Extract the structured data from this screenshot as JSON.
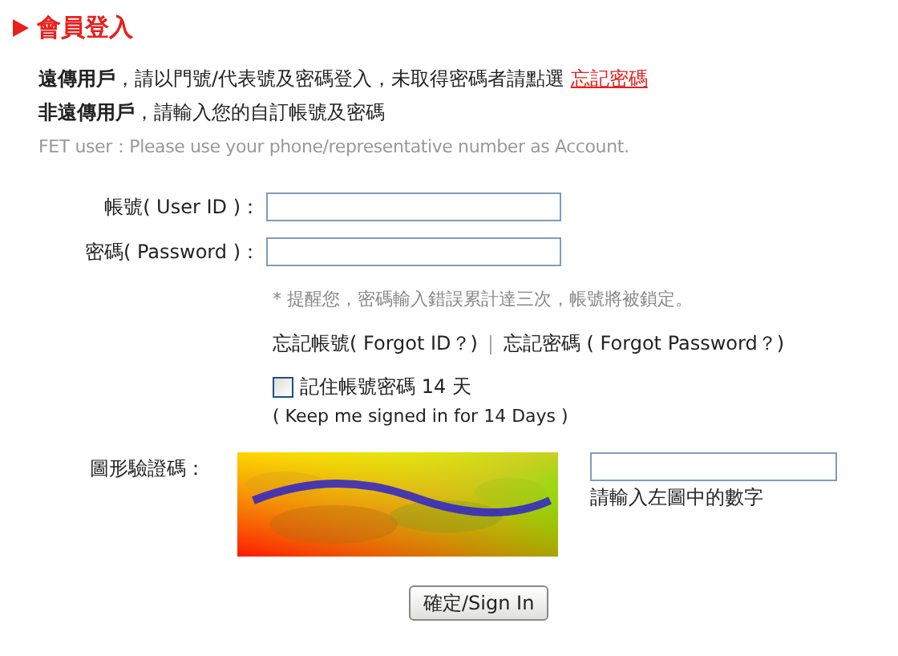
{
  "title": "會員登入",
  "notes": [
    {
      "text": "**遠傳用戶**，請以門號/代表號及密碼登入，未取得密碼者請點選 ",
      "link": "忘記密碼",
      "kind": "main"
    },
    {
      "text": "**非遠傳用戶**，請輸入您的自訂帳號及密碼",
      "kind": "main"
    },
    {
      "text": "FET user：Please use your phone/representative number as Account.",
      "kind": "hint"
    }
  ],
  "fields": [
    {
      "label": "帳號( User ID )："
    },
    {
      "label": "密碼( Password )："
    }
  ],
  "warning": "* 提醒您，密碼輸入錯誤累計達三次，帳號將被鎖定。",
  "forgot_links": [
    "忘記帳號( Forgot ID？)",
    "忘記密碼 ( Forgot Password？)"
  ],
  "separator": "｜",
  "remember": {
    "label": "記住帳號密碼 14 天",
    "sub": "( Keep me signed in for 14 Days )",
    "checked": false
  },
  "captcha": {
    "label": "圖形驗證碼：",
    "hint": "請輸入左圖中的數字"
  },
  "submit": "確定/Sign In"
}
